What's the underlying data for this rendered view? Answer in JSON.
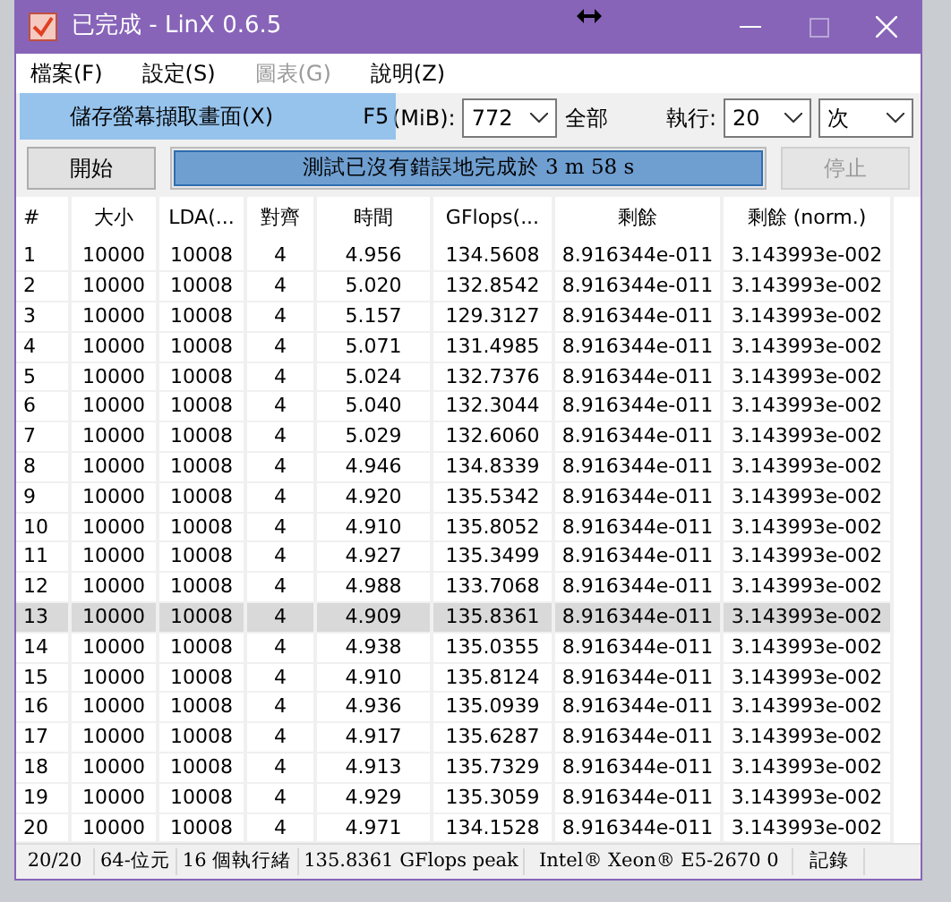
{
  "window": {
    "title": "已完成 - LinX 0.6.5"
  },
  "menu": [
    {
      "label": "檔案(F)",
      "disabled": false
    },
    {
      "label": "設定(S)",
      "disabled": false
    },
    {
      "label": "圖表(G)",
      "disabled": true
    },
    {
      "label": "說明(Z)",
      "disabled": false
    }
  ],
  "tooltip": {
    "text": "儲存螢幕擷取畫面(X)",
    "shortcut": "F5"
  },
  "memory": {
    "label": "(MiB):",
    "value": "772",
    "all_label": "全部"
  },
  "runs": {
    "label": "執行:",
    "value": "20",
    "unit": "次"
  },
  "start_button": {
    "label": "開始",
    "disabled": false
  },
  "progress": {
    "text": "測試已沒有錯誤地完成於 3 m 58 s",
    "level": 1
  },
  "stop_button": {
    "label": "停止",
    "disabled": true
  },
  "table": {
    "columns": [
      "#",
      "大小",
      "LDA(...",
      "對齊",
      "時間",
      "GFlops(...",
      "剩餘",
      "剩餘 (norm.)"
    ],
    "rows": [
      {
        "cells": [
          "1",
          "10000",
          "10008",
          "4",
          "4.956",
          "134.5608",
          "8.916344e-011",
          "3.143993e-002"
        ],
        "selected": false
      },
      {
        "cells": [
          "2",
          "10000",
          "10008",
          "4",
          "5.020",
          "132.8542",
          "8.916344e-011",
          "3.143993e-002"
        ],
        "selected": false
      },
      {
        "cells": [
          "3",
          "10000",
          "10008",
          "4",
          "5.157",
          "129.3127",
          "8.916344e-011",
          "3.143993e-002"
        ],
        "selected": false
      },
      {
        "cells": [
          "4",
          "10000",
          "10008",
          "4",
          "5.071",
          "131.4985",
          "8.916344e-011",
          "3.143993e-002"
        ],
        "selected": false
      },
      {
        "cells": [
          "5",
          "10000",
          "10008",
          "4",
          "5.024",
          "132.7376",
          "8.916344e-011",
          "3.143993e-002"
        ],
        "selected": false
      },
      {
        "cells": [
          "6",
          "10000",
          "10008",
          "4",
          "5.040",
          "132.3044",
          "8.916344e-011",
          "3.143993e-002"
        ],
        "selected": false
      },
      {
        "cells": [
          "7",
          "10000",
          "10008",
          "4",
          "5.029",
          "132.6060",
          "8.916344e-011",
          "3.143993e-002"
        ],
        "selected": false
      },
      {
        "cells": [
          "8",
          "10000",
          "10008",
          "4",
          "4.946",
          "134.8339",
          "8.916344e-011",
          "3.143993e-002"
        ],
        "selected": false
      },
      {
        "cells": [
          "9",
          "10000",
          "10008",
          "4",
          "4.920",
          "135.5342",
          "8.916344e-011",
          "3.143993e-002"
        ],
        "selected": false
      },
      {
        "cells": [
          "10",
          "10000",
          "10008",
          "4",
          "4.910",
          "135.8052",
          "8.916344e-011",
          "3.143993e-002"
        ],
        "selected": false
      },
      {
        "cells": [
          "11",
          "10000",
          "10008",
          "4",
          "4.927",
          "135.3499",
          "8.916344e-011",
          "3.143993e-002"
        ],
        "selected": false
      },
      {
        "cells": [
          "12",
          "10000",
          "10008",
          "4",
          "4.988",
          "133.7068",
          "8.916344e-011",
          "3.143993e-002"
        ],
        "selected": false
      },
      {
        "cells": [
          "13",
          "10000",
          "10008",
          "4",
          "4.909",
          "135.8361",
          "8.916344e-011",
          "3.143993e-002"
        ],
        "selected": true
      },
      {
        "cells": [
          "14",
          "10000",
          "10008",
          "4",
          "4.938",
          "135.0355",
          "8.916344e-011",
          "3.143993e-002"
        ],
        "selected": false
      },
      {
        "cells": [
          "15",
          "10000",
          "10008",
          "4",
          "4.910",
          "135.8124",
          "8.916344e-011",
          "3.143993e-002"
        ],
        "selected": false
      },
      {
        "cells": [
          "16",
          "10000",
          "10008",
          "4",
          "4.936",
          "135.0939",
          "8.916344e-011",
          "3.143993e-002"
        ],
        "selected": false
      },
      {
        "cells": [
          "17",
          "10000",
          "10008",
          "4",
          "4.917",
          "135.6287",
          "8.916344e-011",
          "3.143993e-002"
        ],
        "selected": false
      },
      {
        "cells": [
          "18",
          "10000",
          "10008",
          "4",
          "4.913",
          "135.7329",
          "8.916344e-011",
          "3.143993e-002"
        ],
        "selected": false
      },
      {
        "cells": [
          "19",
          "10000",
          "10008",
          "4",
          "4.929",
          "135.3059",
          "8.916344e-011",
          "3.143993e-002"
        ],
        "selected": false
      },
      {
        "cells": [
          "20",
          "10000",
          "10008",
          "4",
          "4.971",
          "134.1528",
          "8.916344e-011",
          "3.143993e-002"
        ],
        "selected": false
      }
    ]
  },
  "status_bar": [
    "20/20",
    "64-位元",
    "16 個執行緒",
    "135.8361 GFlops peak",
    "Intel® Xeon® E5-2670 0",
    "記錄"
  ]
}
